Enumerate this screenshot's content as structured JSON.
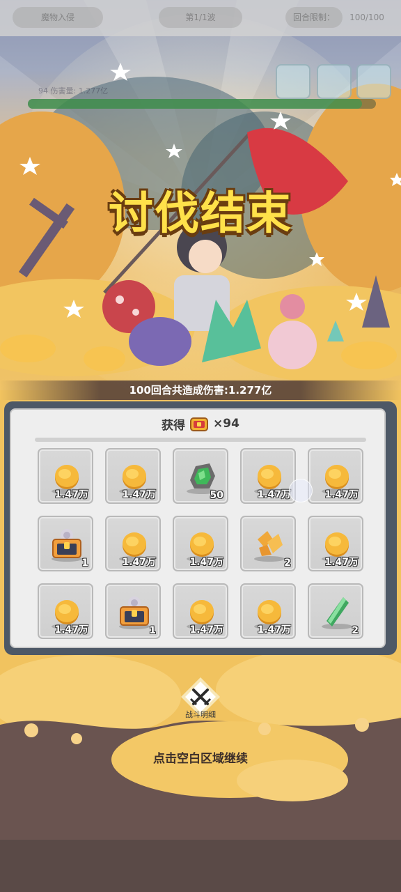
{
  "hud": {
    "left_label": "魔物入侵",
    "center_label": "第1/1波",
    "right_label": "回合限制：",
    "right_value": "100/100",
    "player_info": "94  伤害量: 1.277亿"
  },
  "result": {
    "title": "讨伐结束",
    "damage_summary": "100回合共造成伤害:1.277亿",
    "obtain_label": "获得",
    "obtain_icon": "chest-token-icon",
    "obtain_count": "×94"
  },
  "rewards": [
    {
      "icon": "gold-coin-icon",
      "count": "1.47万"
    },
    {
      "icon": "gold-coin-icon",
      "count": "1.47万"
    },
    {
      "icon": "green-ore-icon",
      "count": "50"
    },
    {
      "icon": "gold-coin-icon",
      "count": "1.47万"
    },
    {
      "icon": "gold-coin-icon",
      "count": "1.47万"
    },
    {
      "icon": "treasure-chest-icon",
      "count": "1"
    },
    {
      "icon": "gold-coin-icon",
      "count": "1.47万"
    },
    {
      "icon": "gold-coin-icon",
      "count": "1.47万"
    },
    {
      "icon": "amber-shards-icon",
      "count": "2"
    },
    {
      "icon": "gold-coin-icon",
      "count": "1.47万"
    },
    {
      "icon": "gold-coin-icon",
      "count": "1.47万"
    },
    {
      "icon": "treasure-chest-icon",
      "count": "1"
    },
    {
      "icon": "gold-coin-icon",
      "count": "1.47万"
    },
    {
      "icon": "gold-coin-icon",
      "count": "1.47万"
    },
    {
      "icon": "green-crystal-icon",
      "count": "2"
    }
  ],
  "battle_detail": {
    "label": "战斗明细",
    "icon": "crossed-swords-icon"
  },
  "continue_hint": "点击空白区域继续",
  "colors": {
    "panel_frame": "#4d5866",
    "panel_bg": "#eeeeee",
    "title_fill": "#ffe14a",
    "title_outline": "#6a3d10",
    "coin": "#f6b93b"
  }
}
